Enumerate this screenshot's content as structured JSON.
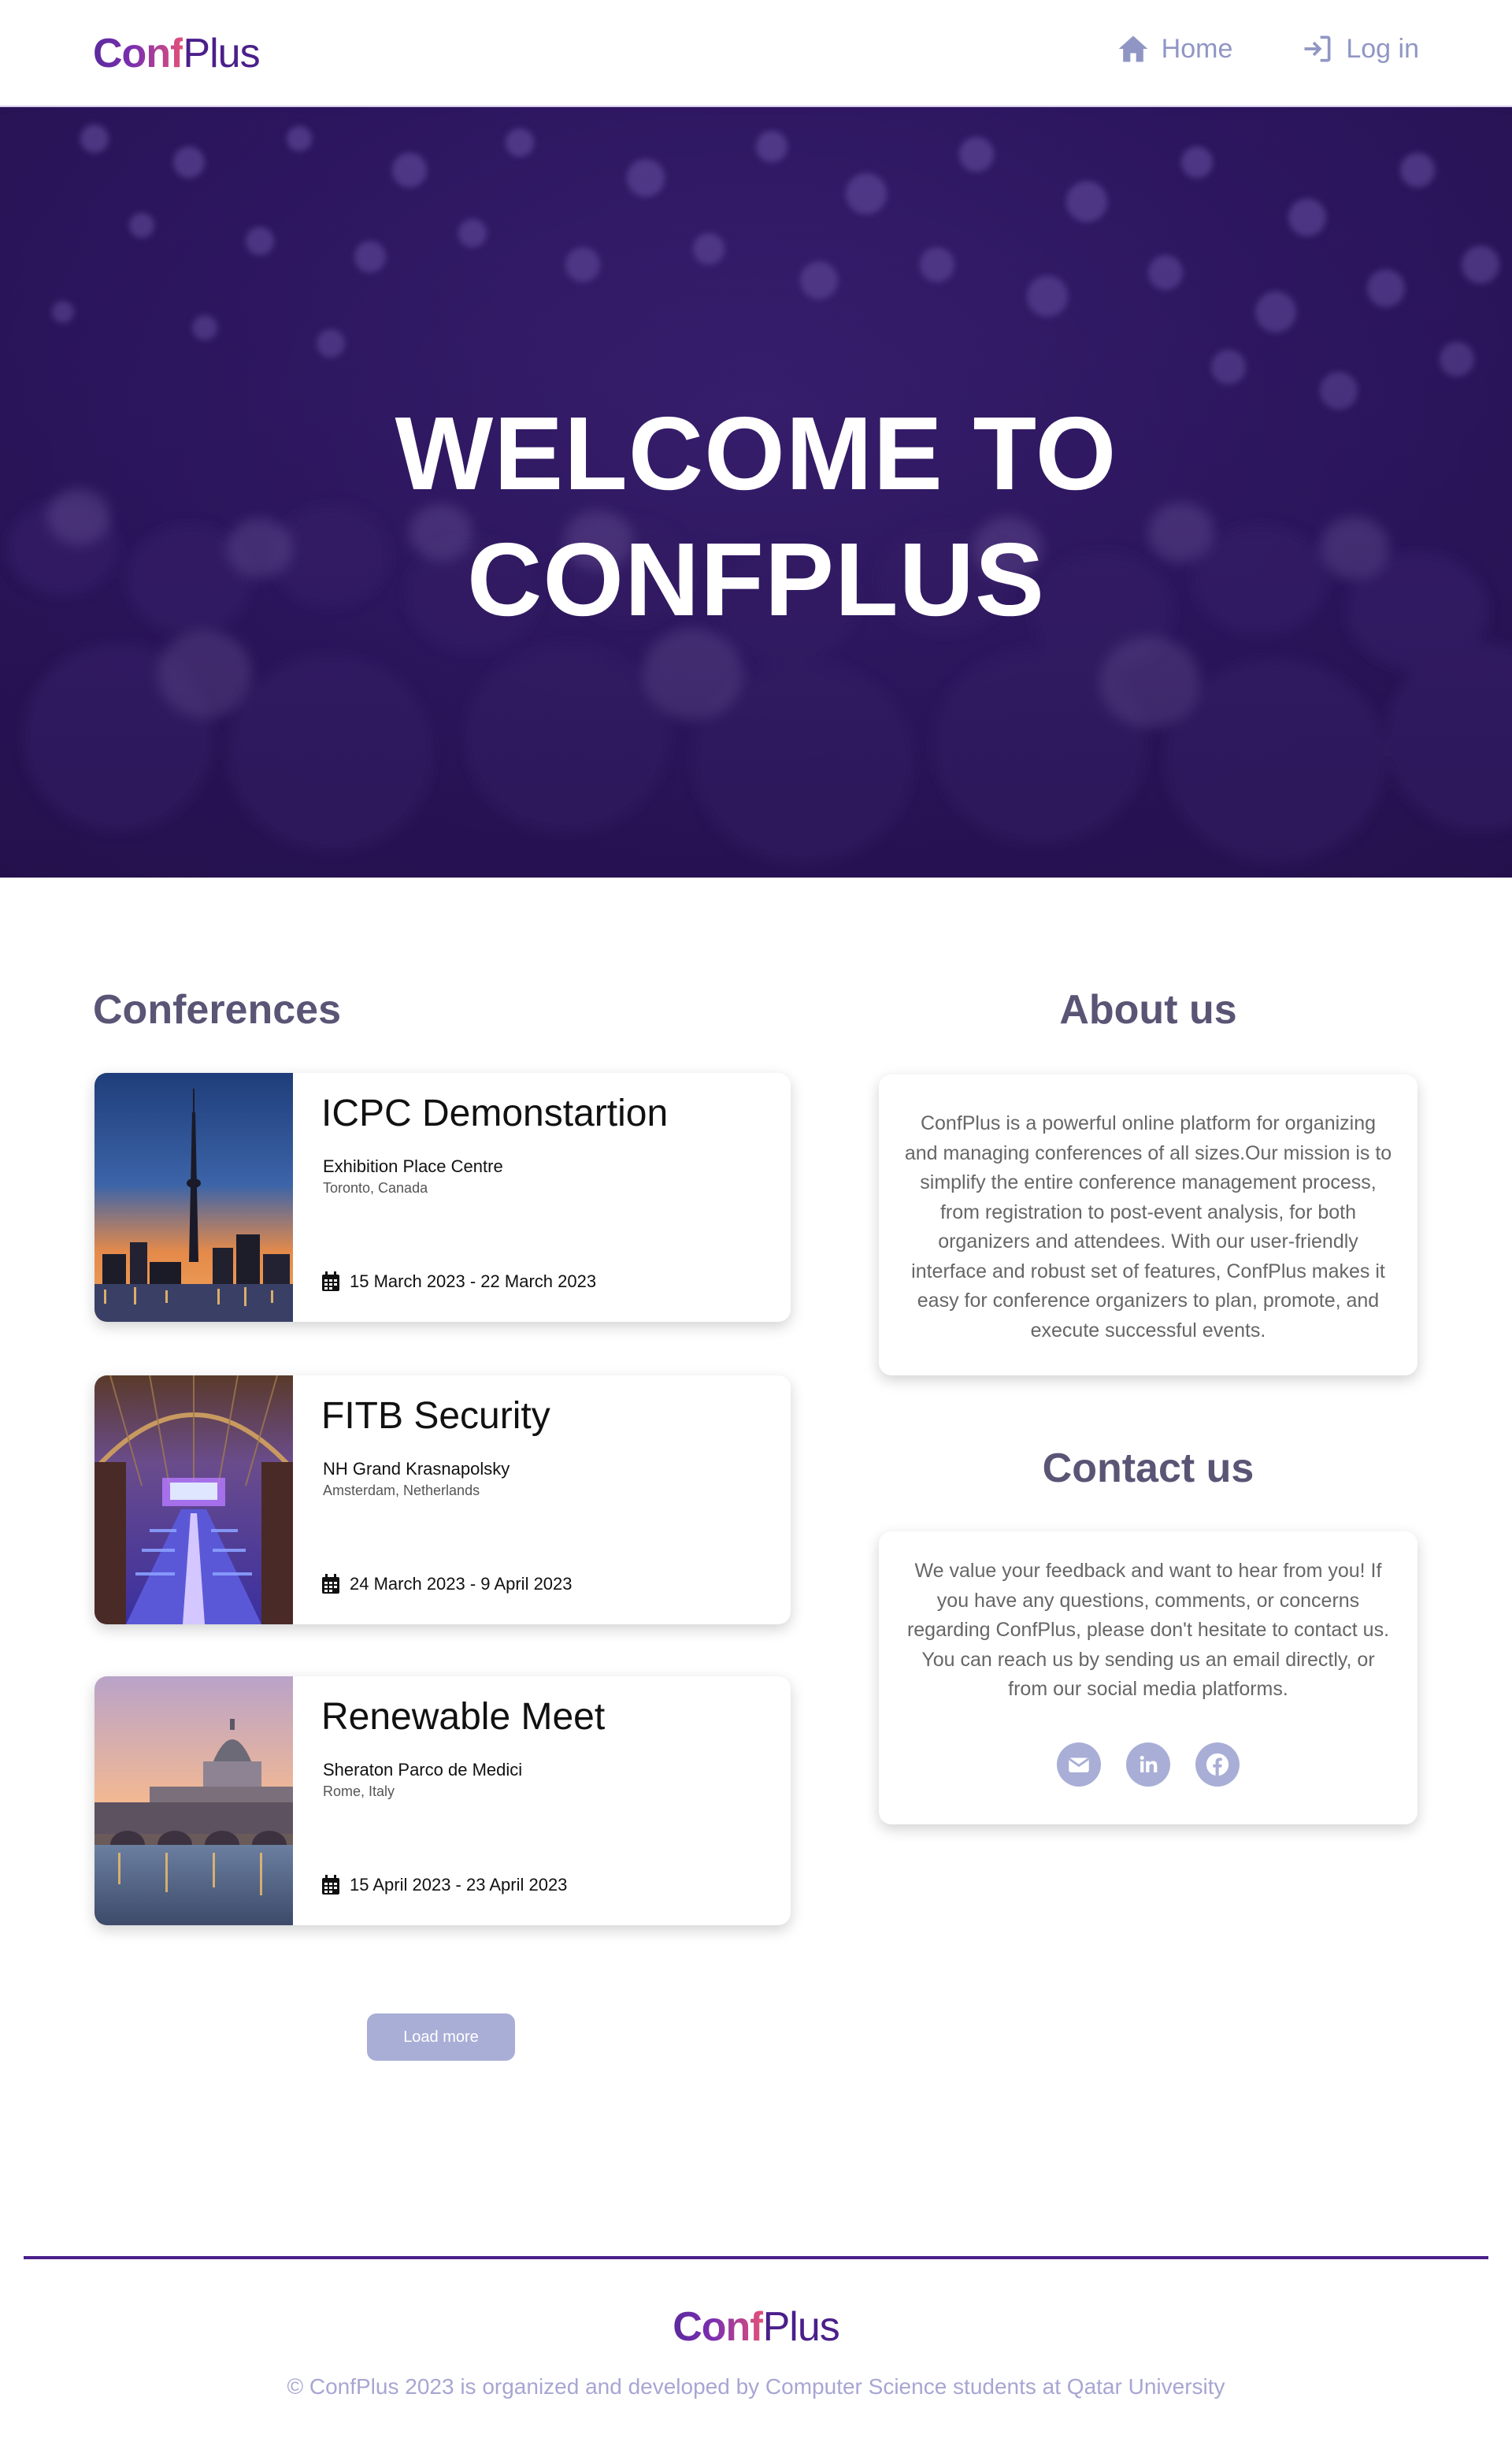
{
  "header": {
    "logo_conf": "Conf",
    "logo_plus": "Plus",
    "nav": [
      {
        "label": "Home",
        "icon": "home-icon"
      },
      {
        "label": "Log in",
        "icon": "login-icon"
      }
    ]
  },
  "hero": {
    "line1": "WELCOME TO",
    "line2": "CONFPLUS"
  },
  "conferences": {
    "title": "Conferences",
    "items": [
      {
        "title": "ICPC Demonstartion",
        "venue": "Exhibition Place Centre",
        "location": "Toronto, Canada",
        "dates": "15 March 2023 - 22 March 2023",
        "image": "cn-tower-skyline-image"
      },
      {
        "title": "FITB Security",
        "venue": "NH Grand Krasnapolsky",
        "location": "Amsterdam, Netherlands",
        "dates": "24 March 2023 - 9 April 2023",
        "image": "conference-hall-image"
      },
      {
        "title": "Renewable Meet",
        "venue": "Sheraton Parco de Medici",
        "location": "Rome, Italy",
        "dates": "15 April 2023 - 23 April 2023",
        "image": "rome-basilica-image"
      }
    ],
    "load_more_label": "Load more"
  },
  "about": {
    "title": "About us",
    "text": "ConfPlus is a powerful online platform for organizing and managing conferences of all sizes.Our mission is to simplify the entire conference management process, from registration to post-event analysis, for both organizers and attendees. With our user-friendly interface and robust set of features, ConfPlus makes it easy for conference organizers to plan, promote, and execute successful events."
  },
  "contact": {
    "title": "Contact us",
    "text": "We value your feedback and want to hear from you! If you have any questions, comments, or concerns regarding ConfPlus, please don't hesitate to contact us. You can reach us by sending us an email directly, or from our social media platforms.",
    "socials": [
      "email-icon",
      "linkedin-icon",
      "facebook-icon"
    ]
  },
  "footer": {
    "logo_conf": "Conf",
    "logo_plus": "Plus",
    "copyright": "© ConfPlus 2023 is organized and developed by Computer Science students at Qatar University"
  },
  "colors": {
    "brand_purple": "#4b1f8a",
    "hero_bg": "#2d1660",
    "nav_text": "#9096c4",
    "button_bg": "#a9aed6",
    "heading_gray": "#5a5475"
  }
}
